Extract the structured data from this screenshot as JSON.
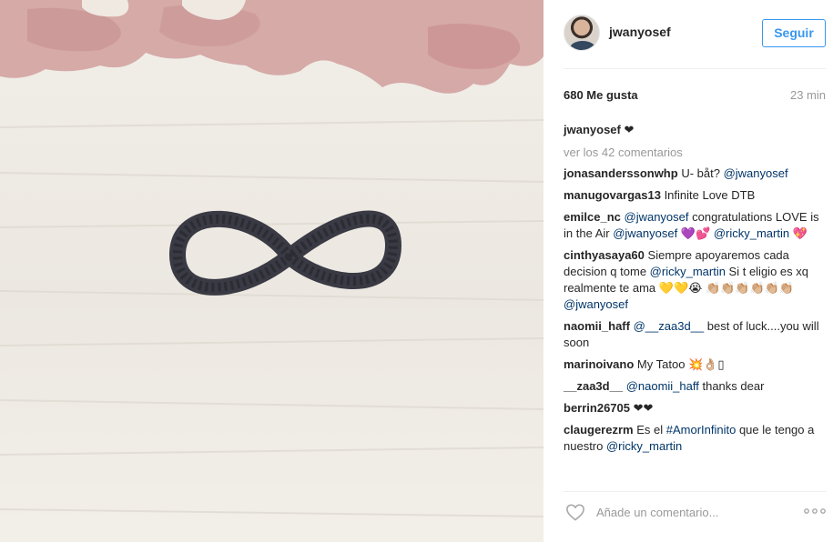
{
  "header": {
    "username": "jwanyosef",
    "follow_label": "Seguir"
  },
  "post": {
    "likes": "680 Me gusta",
    "time": "23 min",
    "caption_user": "jwanyosef",
    "caption_text": "❤",
    "view_all": "ver los 42 comentarios"
  },
  "comments": [
    {
      "user": "jonasanderssonwhp",
      "parts": [
        {
          "t": "U- båt? "
        },
        {
          "m": "@jwanyosef"
        }
      ]
    },
    {
      "user": "manugovargas13",
      "parts": [
        {
          "t": "Infinite Love DTB"
        }
      ]
    },
    {
      "user": "emilce_nc",
      "parts": [
        {
          "m": "@jwanyosef"
        },
        {
          "t": " congratulations LOVE is in the Air "
        },
        {
          "m": "@jwanyosef"
        },
        {
          "t": " 💜💕 "
        },
        {
          "m": "@ricky_martin"
        },
        {
          "t": " 💖"
        }
      ]
    },
    {
      "user": "cinthyasaya60",
      "parts": [
        {
          "t": "Siempre apoyaremos cada decision q tome "
        },
        {
          "m": "@ricky_martin"
        },
        {
          "t": " Si t eligio es xq realmente te ama 💛💛😭 👏🏼👏🏼👏🏼👏🏼👏🏼👏🏼"
        },
        {
          "m": "@jwanyosef"
        }
      ]
    },
    {
      "user": "naomii_haff",
      "parts": [
        {
          "m": "@__zaa3d__"
        },
        {
          "t": " best of luck....you will soon"
        }
      ]
    },
    {
      "user": "marinoivano",
      "parts": [
        {
          "t": "My Tatoo 💥👌🏼▯"
        }
      ]
    },
    {
      "user": "__zaa3d__",
      "parts": [
        {
          "m": "@naomii_haff"
        },
        {
          "t": " thanks dear"
        }
      ]
    },
    {
      "user": "berrin26705",
      "parts": [
        {
          "t": "❤❤"
        }
      ]
    },
    {
      "user": "claugerezrm",
      "parts": [
        {
          "t": "Es el "
        },
        {
          "m": "#AmorInfinito"
        },
        {
          "t": " que le tengo a nuestro "
        },
        {
          "m": "@ricky_martin"
        }
      ]
    }
  ],
  "footer": {
    "placeholder": "Añade un comentario..."
  },
  "icons": {
    "heart": "heart-outline-icon",
    "more": "more-options-icon"
  },
  "colors": {
    "link": "#003569",
    "follow": "#3897f0",
    "muted": "#999999"
  }
}
